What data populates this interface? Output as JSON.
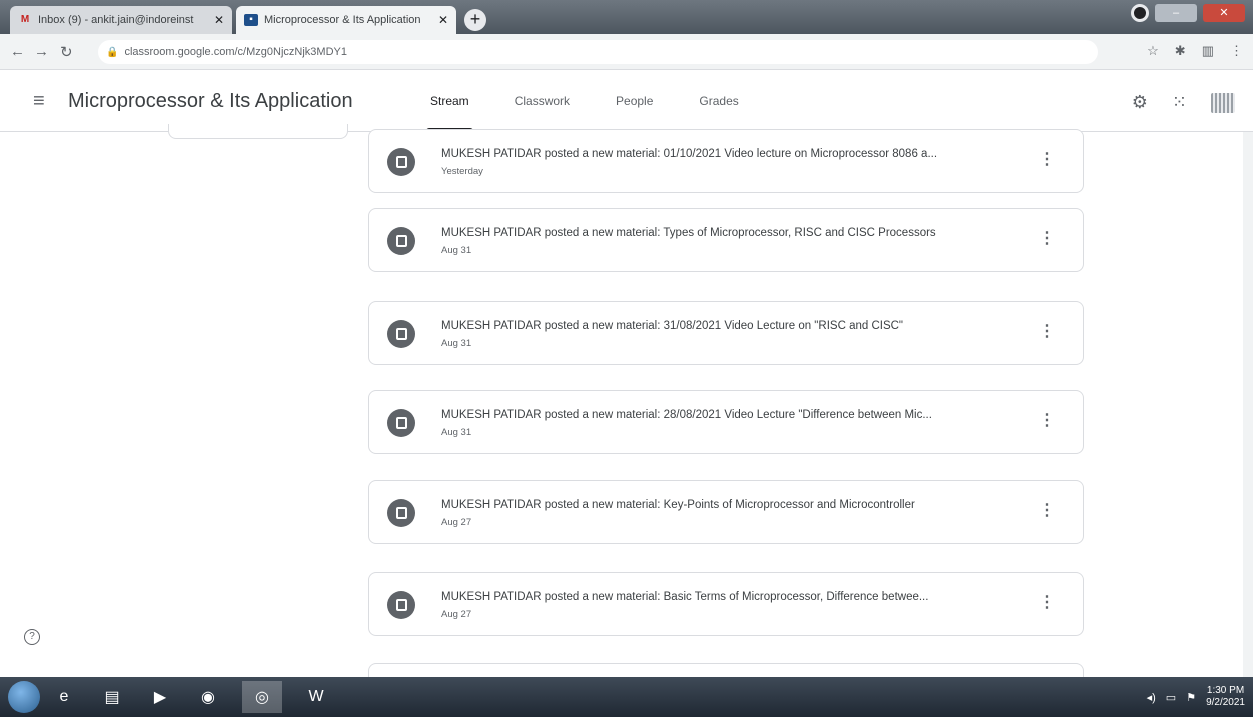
{
  "browser": {
    "tabs": [
      {
        "title": "Inbox (9) - ankit.jain@indoreinst",
        "icon": "gmail-icon"
      },
      {
        "title": "Microprocessor & Its Application",
        "icon": "classroom-icon"
      }
    ],
    "url": "classroom.google.com/c/Mzg0NjczNjk3MDY1"
  },
  "header": {
    "title": "Microprocessor & Its Application",
    "tabs": [
      "Stream",
      "Classwork",
      "People",
      "Grades"
    ],
    "active_tab": "Stream"
  },
  "stream": [
    {
      "text": "MUKESH PATIDAR posted a new material: 01/10/2021 Video lecture on Microprocessor 8086 a...",
      "date": "Yesterday"
    },
    {
      "text": "MUKESH PATIDAR posted a new material: Types of Microprocessor, RISC and CISC Processors",
      "date": "Aug 31"
    },
    {
      "text": "MUKESH PATIDAR posted a new material: 31/08/2021 Video Lecture on \"RISC and CISC\"",
      "date": "Aug 31"
    },
    {
      "text": "MUKESH PATIDAR posted a new material: 28/08/2021 Video Lecture \"Difference between Mic...",
      "date": "Aug 31"
    },
    {
      "text": "MUKESH PATIDAR posted a new material: Key-Points of Microprocessor and Microcontroller",
      "date": "Aug 27"
    },
    {
      "text": "MUKESH PATIDAR posted a new material: Basic Terms of Microprocessor, Difference betwee...",
      "date": "Aug 27"
    }
  ],
  "taskbar": {
    "time": "1:30 PM",
    "date": "9/2/2021"
  },
  "colors": {
    "accent": "#202124",
    "material_icon": "#5f6368",
    "card_border": "#dadce0"
  }
}
